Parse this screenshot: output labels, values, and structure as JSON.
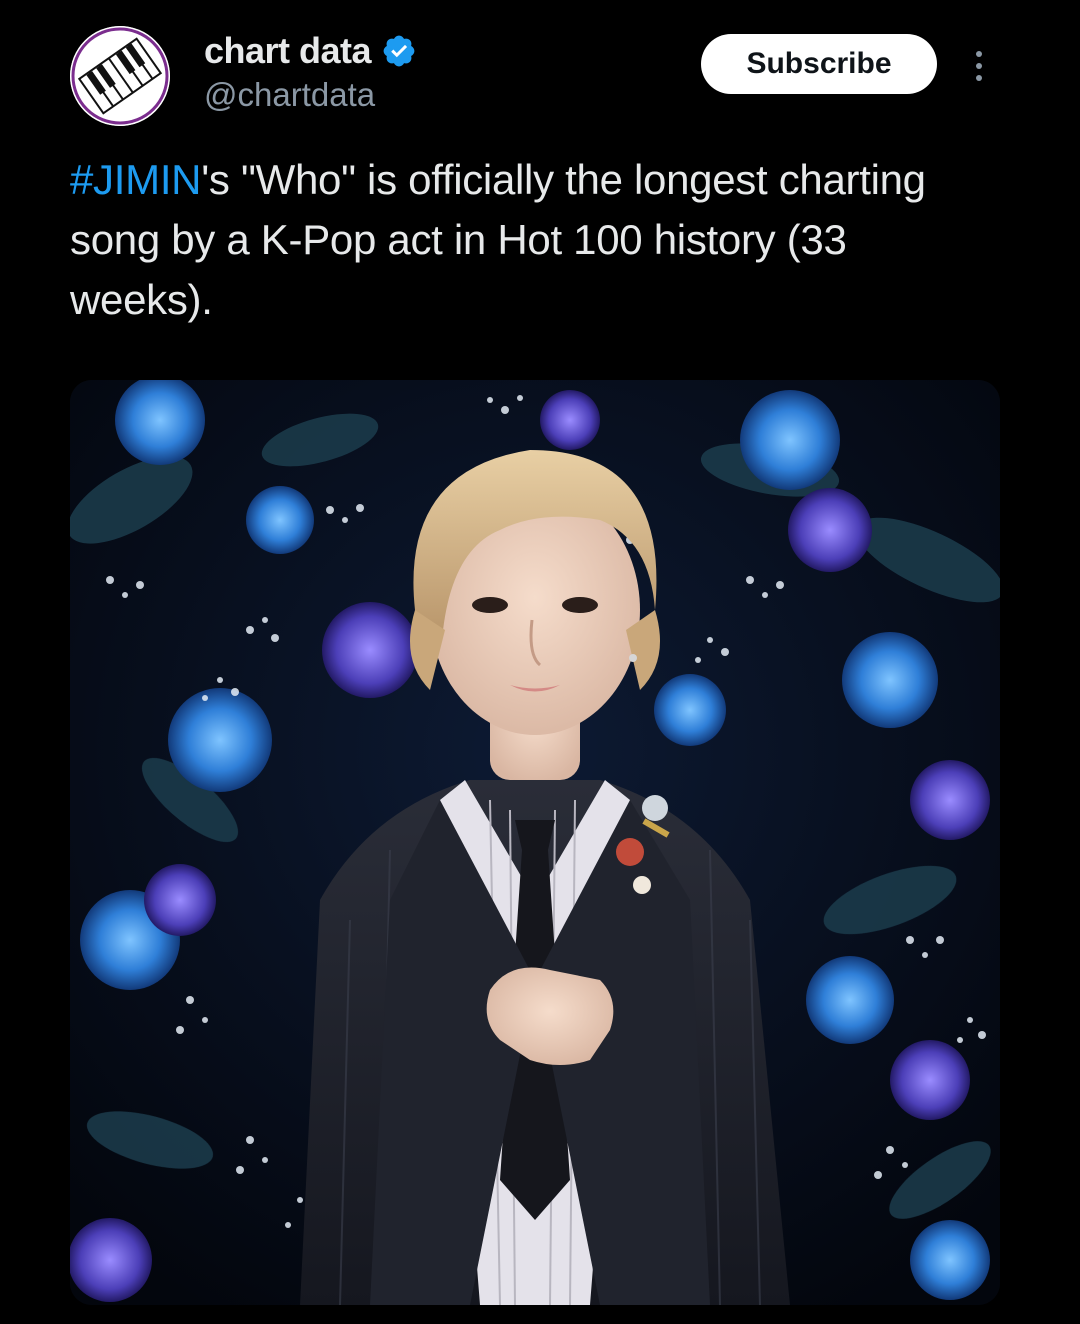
{
  "author": {
    "display_name": "chart data",
    "handle": "@chartdata",
    "verified_icon": "verified-badge-icon",
    "avatar_icon": "piano-keys-logo"
  },
  "actions": {
    "subscribe_label": "Subscribe",
    "more_icon": "more-vertical-icon"
  },
  "tweet": {
    "hashtag": "#JIMIN",
    "text_after_hashtag": "'s \"Who\" is officially the longest charting song by a K-Pop act in Hot 100 history (33 weeks)."
  },
  "colors": {
    "background": "#000000",
    "accent": "#1d9bf0",
    "text_primary": "#e7e9ea",
    "text_secondary": "#8b98a5",
    "subscribe_bg": "#ffffff"
  }
}
